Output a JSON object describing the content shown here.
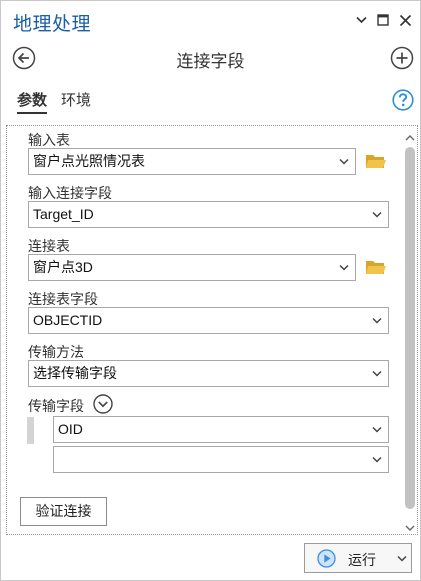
{
  "titlebar": {
    "title": "地理处理",
    "menu_icon": "chevron-down-icon",
    "maximize_icon": "maximize-icon",
    "close_icon": "close-icon"
  },
  "header": {
    "tool_title": "连接字段",
    "back_icon": "back-arrow-icon",
    "add_icon": "add-icon"
  },
  "tabs": [
    {
      "label": "参数",
      "active": true
    },
    {
      "label": "环境",
      "active": false
    }
  ],
  "help_icon": "help-icon",
  "params": {
    "input_table": {
      "label": "输入表",
      "value": "窗户点光照情况表"
    },
    "input_join_field": {
      "label": "输入连接字段",
      "value": "Target_ID"
    },
    "join_table": {
      "label": "连接表",
      "value": "窗户点3D"
    },
    "join_table_field": {
      "label": "连接表字段",
      "value": "OBJECTID"
    },
    "transfer_method": {
      "label": "传输方法",
      "value": "选择传输字段"
    },
    "transfer_fields": {
      "label": "传输字段",
      "values": [
        "OID",
        ""
      ]
    },
    "verify_button": "验证连接"
  },
  "footer": {
    "run_label": "运行"
  },
  "colors": {
    "title_blue": "#1a5fa8",
    "help_blue": "#2a8fd8",
    "folder_yellow": "#e8b93a",
    "run_blue": "#3a8ee6"
  }
}
